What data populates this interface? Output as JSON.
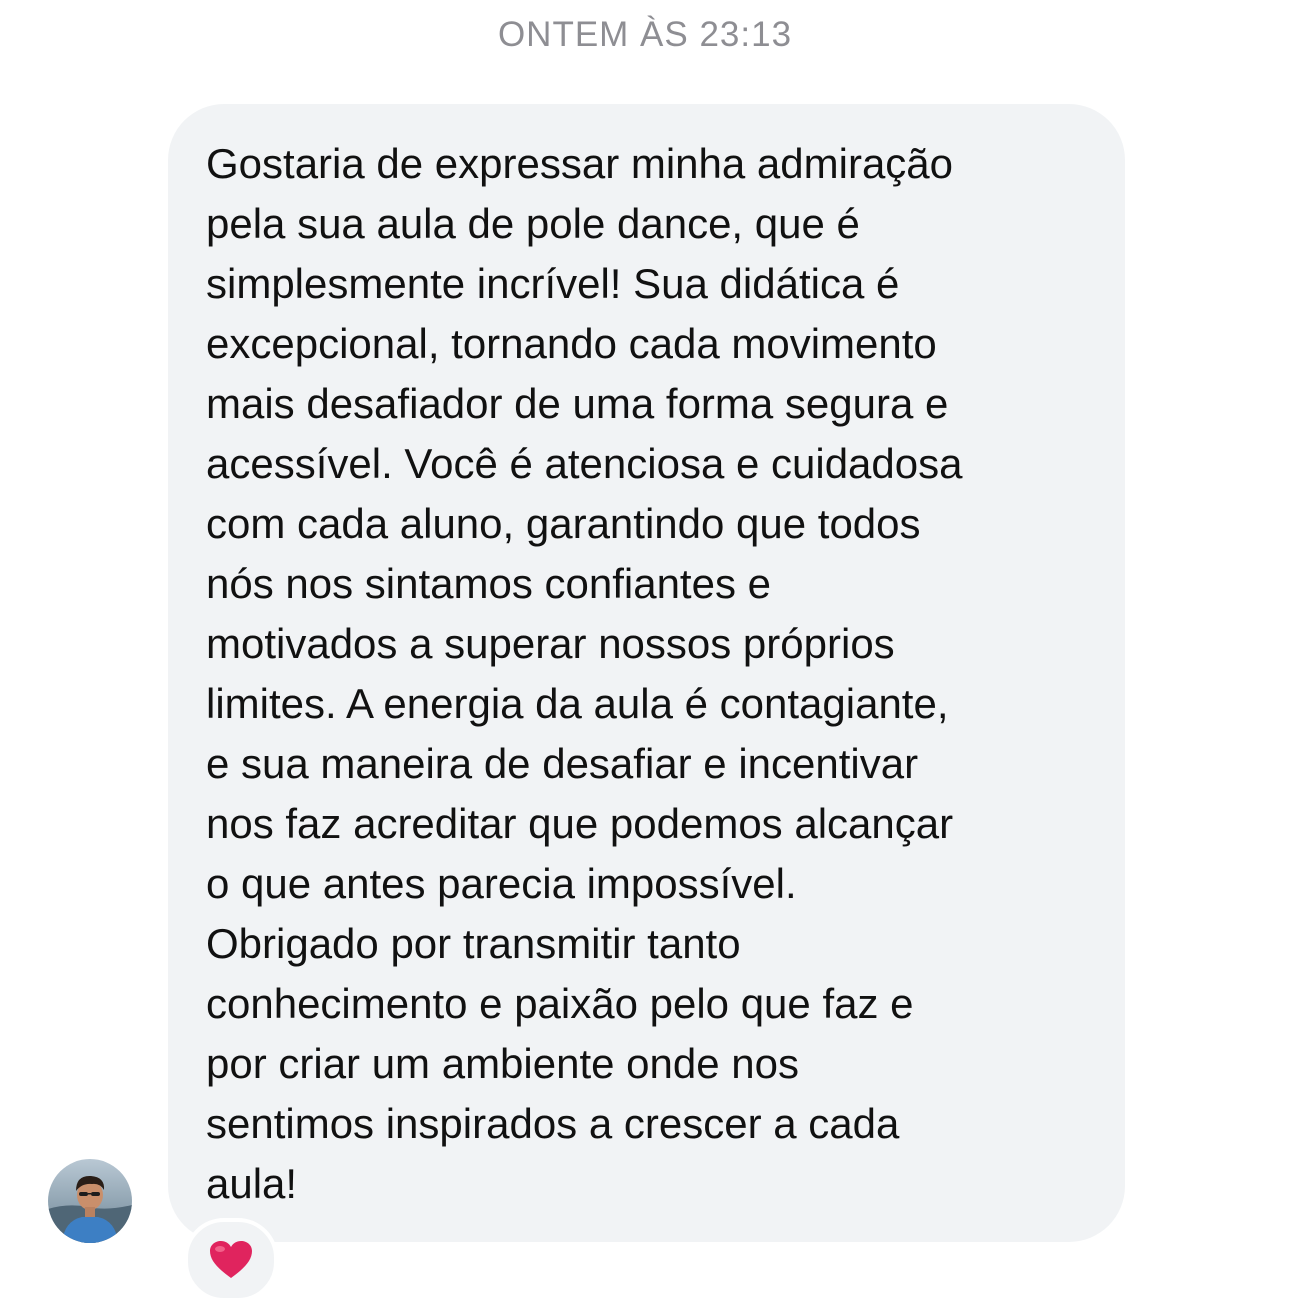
{
  "thread": {
    "timestamp": "ONTEM ÀS 23:13"
  },
  "message": {
    "lines": [
      "Gostaria de expressar minha admiração",
      "pela sua aula de pole dance, que é",
      "simplesmente incrível! Sua didática é",
      "excepcional, tornando cada movimento",
      "mais desafiador de uma forma segura e",
      "acessível. Você é atenciosa e cuidadosa",
      "com cada aluno, garantindo que todos",
      "nós nos sintamos confiantes e",
      "motivados a superar nossos próprios",
      "limites. A energia da aula é contagiante,",
      "e sua maneira de desafiar e incentivar",
      "nos faz acreditar que podemos alcançar",
      "o que antes parecia impossível.",
      "Obrigado por transmitir tanto",
      "conhecimento e paixão pelo que faz e",
      "por criar um ambiente onde nos",
      "sentimos inspirados a crescer a cada",
      "aula!"
    ]
  },
  "sender": {
    "avatar_icon": "user-avatar-photo"
  },
  "reaction": {
    "icon": "red-heart-icon",
    "color": "#e0245e"
  },
  "colors": {
    "bubble_background": "#f1f3f5",
    "timestamp_text": "#8e8e93",
    "message_text": "#111111"
  }
}
